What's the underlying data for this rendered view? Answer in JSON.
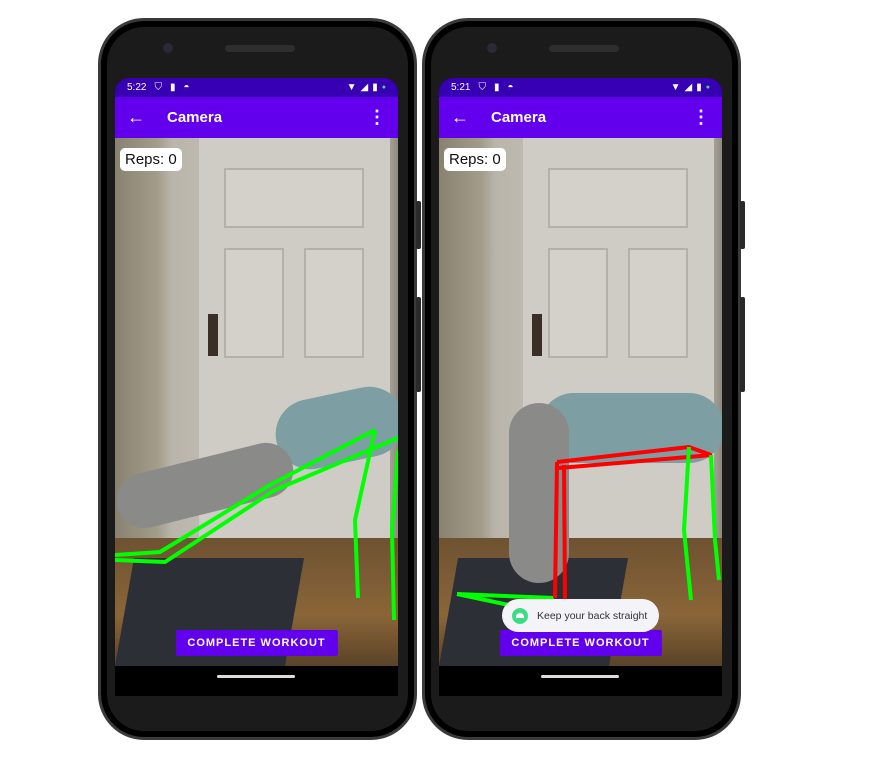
{
  "phones": [
    {
      "status": {
        "time": "5:22"
      },
      "toolbar": {
        "title": "Camera"
      },
      "reps_label": "Reps: 0",
      "complete_button": "COMPLETE WORKOUT"
    },
    {
      "status": {
        "time": "5:21"
      },
      "toolbar": {
        "title": "Camera"
      },
      "reps_label": "Reps: 0",
      "complete_button": "COMPLETE WORKOUT",
      "toast": "Keep your back straight"
    }
  ],
  "icons": {
    "back": "arrow-left-icon",
    "more": "more-vert-icon"
  },
  "colors": {
    "primary": "#6200ee",
    "primary_dark": "#3700b3",
    "good_pose": "#00ff00",
    "bad_pose": "#ff0000"
  }
}
